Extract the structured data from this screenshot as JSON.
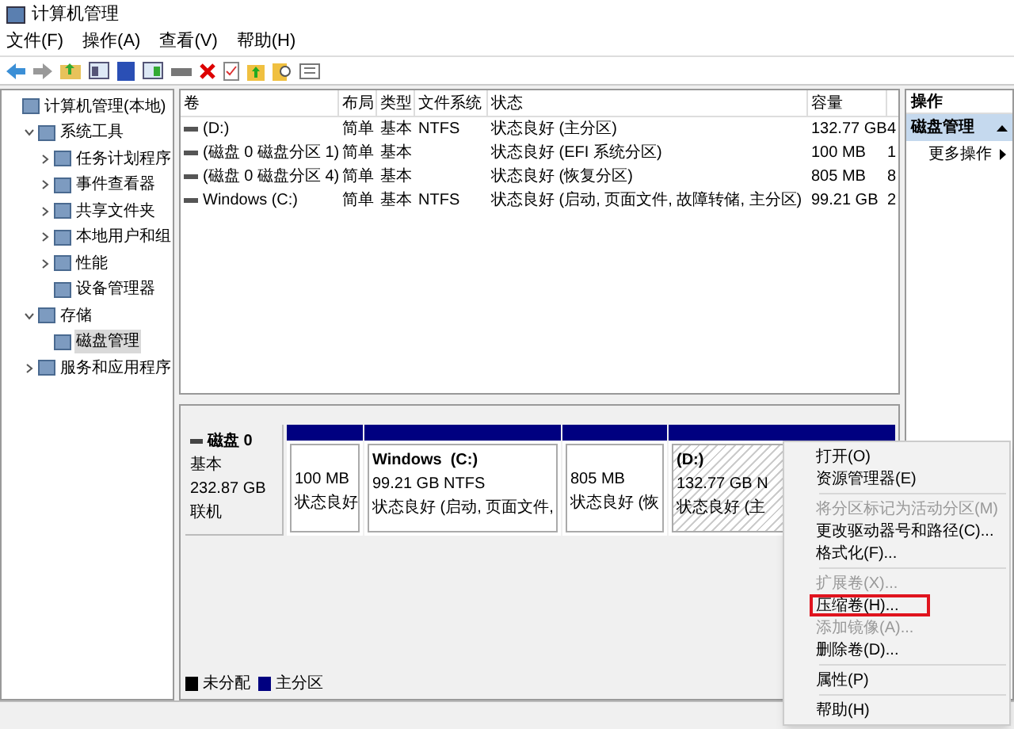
{
  "window": {
    "title": "计算机管理"
  },
  "menu": [
    "文件(F)",
    "操作(A)",
    "查看(V)",
    "帮助(H)"
  ],
  "tree": [
    {
      "label": "计算机管理(本地)",
      "selected": false,
      "children": [
        {
          "label": "系统工具",
          "expanded": true,
          "selected": false,
          "children": [
            {
              "label": "任务计划程序",
              "expanded": false,
              "selected": false
            },
            {
              "label": "事件查看器",
              "expanded": false,
              "selected": false
            },
            {
              "label": "共享文件夹",
              "expanded": false,
              "selected": false
            },
            {
              "label": "本地用户和组",
              "expanded": false,
              "selected": false
            },
            {
              "label": "性能",
              "expanded": false,
              "selected": false
            },
            {
              "label": "设备管理器",
              "selected": false
            }
          ]
        },
        {
          "label": "存储",
          "expanded": true,
          "selected": false,
          "children": [
            {
              "label": "磁盘管理",
              "selected": true
            }
          ]
        },
        {
          "label": "服务和应用程序",
          "expanded": false,
          "selected": false
        }
      ]
    }
  ],
  "table": {
    "columns": [
      "卷",
      "布局",
      "类型",
      "文件系统",
      "状态",
      "容量"
    ],
    "rows": [
      [
        "(D:)",
        "简单",
        "基本",
        "NTFS",
        "状态良好 (主分区)",
        "132.77 GB",
        "4"
      ],
      [
        "(磁盘 0 磁盘分区 1)",
        "简单",
        "基本",
        "",
        "状态良好 (EFI 系统分区)",
        "100 MB",
        "1"
      ],
      [
        "(磁盘 0 磁盘分区 4)",
        "简单",
        "基本",
        "",
        "状态良好 (恢复分区)",
        "805 MB",
        "8"
      ],
      [
        "Windows (C:)",
        "简单",
        "基本",
        "NTFS",
        "状态良好 (启动, 页面文件, 故障转储, 主分区)",
        "99.21 GB",
        "2"
      ]
    ]
  },
  "disk": {
    "name": "磁盘 0",
    "type": "基本",
    "size": "232.87 GB",
    "status": "联机",
    "partitions": [
      {
        "size": "100 MB",
        "status": "状态良好",
        "selected": false
      },
      {
        "name": "Windows  (C:)",
        "size": "99.21 GB NTFS",
        "status": "状态良好 (启动, 页面文件,",
        "selected": false
      },
      {
        "size": "805 MB",
        "status": "状态良好 (恢",
        "selected": false
      },
      {
        "name": "(D:)",
        "size": "132.77 GB N",
        "status": "状态良好 (主",
        "selected": true
      }
    ]
  },
  "legend": [
    {
      "label": "未分配",
      "color": "#000000"
    },
    {
      "label": "主分区",
      "color": "#000080"
    }
  ],
  "actions": {
    "title": "操作",
    "section": "磁盘管理",
    "items": [
      "更多操作"
    ]
  },
  "context_menu": [
    {
      "kind": "item",
      "label": "打开(O)",
      "disabled": false,
      "annotated": false
    },
    {
      "kind": "item",
      "label": "资源管理器(E)",
      "disabled": false,
      "annotated": false
    },
    {
      "kind": "separator"
    },
    {
      "kind": "item",
      "label": "将分区标记为活动分区(M)",
      "disabled": true,
      "annotated": false
    },
    {
      "kind": "item",
      "label": "更改驱动器号和路径(C)...",
      "disabled": false,
      "annotated": false
    },
    {
      "kind": "item",
      "label": "格式化(F)...",
      "disabled": false,
      "annotated": false
    },
    {
      "kind": "separator"
    },
    {
      "kind": "item",
      "label": "扩展卷(X)...",
      "disabled": true,
      "annotated": false
    },
    {
      "kind": "item",
      "label": "压缩卷(H)...",
      "disabled": false,
      "annotated": true
    },
    {
      "kind": "item",
      "label": "添加镜像(A)...",
      "disabled": true,
      "annotated": false
    },
    {
      "kind": "item",
      "label": "删除卷(D)...",
      "disabled": false,
      "annotated": false
    },
    {
      "kind": "separator"
    },
    {
      "kind": "item",
      "label": "属性(P)",
      "disabled": false,
      "annotated": false
    },
    {
      "kind": "separator"
    },
    {
      "kind": "item",
      "label": "帮助(H)",
      "disabled": false,
      "annotated": false
    }
  ]
}
